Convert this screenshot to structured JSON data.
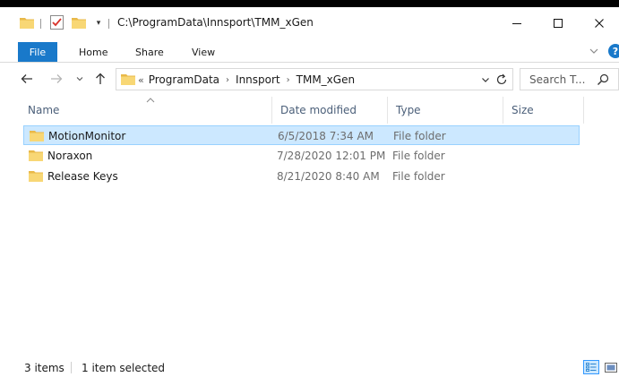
{
  "window": {
    "title": "C:\\ProgramData\\Innsport\\TMM_xGen",
    "minimize_glyph": "—",
    "maximize_glyph": "☐",
    "close_glyph": "✕"
  },
  "ribbon": {
    "tabs": [
      {
        "label": "File",
        "active": true
      },
      {
        "label": "Home"
      },
      {
        "label": "Share"
      },
      {
        "label": "View"
      }
    ],
    "help_glyph": "?"
  },
  "address": {
    "overflow": "«",
    "crumbs": [
      "ProgramData",
      "Innsport",
      "TMM_xGen"
    ],
    "crumb_sep": "›"
  },
  "search": {
    "placeholder": "Search T..."
  },
  "columns": [
    {
      "label": "Name"
    },
    {
      "label": "Date modified"
    },
    {
      "label": "Type"
    },
    {
      "label": "Size"
    }
  ],
  "files": [
    {
      "name": "MotionMonitor",
      "date": "6/5/2018 7:34 AM",
      "type": "File folder",
      "selected": true
    },
    {
      "name": "Noraxon",
      "date": "7/28/2020 12:01 PM",
      "type": "File folder",
      "selected": false
    },
    {
      "name": "Release Keys",
      "date": "8/21/2020 8:40 AM",
      "type": "File folder",
      "selected": false
    }
  ],
  "status": {
    "item_count": "3 items",
    "selection": "1 item selected"
  },
  "colors": {
    "accent": "#1979ca",
    "selection_bg": "#cce8ff",
    "selection_border": "#99d1ff",
    "folder": "#f8d775"
  }
}
